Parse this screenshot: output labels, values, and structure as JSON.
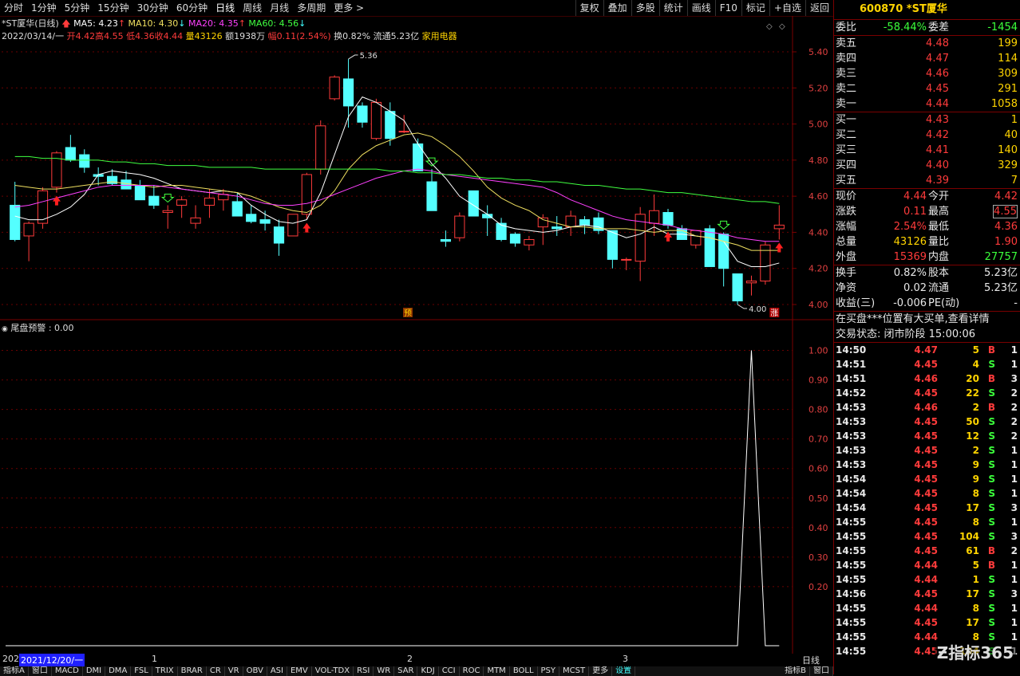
{
  "toolbar": {
    "left": [
      "分时",
      "1分钟",
      "5分钟",
      "15分钟",
      "30分钟",
      "60分钟",
      "日线",
      "周线",
      "月线",
      "多周期",
      "更多 >"
    ],
    "right": [
      "复权",
      "叠加",
      "多股",
      "统计",
      "画线",
      "F10",
      "标记",
      "+自选",
      "返回"
    ]
  },
  "legend": {
    "title": "*ST厦华(日线)",
    "ma5": "MA5: 4.23",
    "ma10": "MA10: 4.30",
    "ma20": "MA20: 4.35",
    "ma60": "MA60: 4.56"
  },
  "ohlc_line": {
    "date": "2022/03/14/一",
    "open": "开4.42",
    "high": "高4.55",
    "low": "低4.36",
    "close": "收4.44",
    "vol": "量43126",
    "amount": "额1938万",
    "change": "幅0.11(2.54%)",
    "turnover": "换0.82%",
    "float": "流通5.23亿",
    "industry": "家用电器"
  },
  "indicator": {
    "label": "尾盘预警 : 0.00"
  },
  "annotations": {
    "high_label": "5.36",
    "low_label": "4.00",
    "yu_tag": "预",
    "zhang_tag": "涨"
  },
  "bottom_tabs": [
    "指标A",
    "窗口",
    "MACD",
    "DMI",
    "DMA",
    "FSL",
    "TRIX",
    "BRAR",
    "CR",
    "VR",
    "OBV",
    "ASI",
    "EMV",
    "VOL-TDX",
    "RSI",
    "WR",
    "SAR",
    "KDJ",
    "CCI",
    "ROC",
    "MTM",
    "BOLL",
    "PSY",
    "MCST",
    "更多",
    "设置"
  ],
  "bottom_right_tabs": [
    "指标B",
    "窗口"
  ],
  "date_bar": {
    "cursor_date": "2021/12/20/一",
    "prefix": "202",
    "m1": "1",
    "m2": "2",
    "m3": "3",
    "period": "日线"
  },
  "chart_data": {
    "type": "candlestick",
    "ylim": [
      4.0,
      5.4
    ],
    "yticks": [
      "5.40",
      "5.20",
      "5.00",
      "4.80",
      "4.60",
      "4.40",
      "4.20",
      "4.00"
    ],
    "candles": [
      [
        4.55,
        4.68,
        4.35,
        4.36
      ],
      [
        4.38,
        4.46,
        4.24,
        4.45
      ],
      [
        4.45,
        4.65,
        4.42,
        4.63
      ],
      [
        4.65,
        4.85,
        4.62,
        4.84
      ],
      [
        4.87,
        4.94,
        4.79,
        4.8
      ],
      [
        4.83,
        4.86,
        4.73,
        4.76
      ],
      [
        4.72,
        4.76,
        4.66,
        4.71
      ],
      [
        4.71,
        4.75,
        4.66,
        4.67
      ],
      [
        4.69,
        4.74,
        4.65,
        4.64
      ],
      [
        4.66,
        4.69,
        4.59,
        4.58
      ],
      [
        4.6,
        4.66,
        4.53,
        4.55
      ],
      [
        4.51,
        4.55,
        4.42,
        4.52
      ],
      [
        4.55,
        4.6,
        4.48,
        4.58
      ],
      [
        4.45,
        4.55,
        4.42,
        4.48
      ],
      [
        4.55,
        4.64,
        4.48,
        4.59
      ],
      [
        4.58,
        4.64,
        4.52,
        4.61
      ],
      [
        4.57,
        4.62,
        4.5,
        4.49
      ],
      [
        4.5,
        4.55,
        4.45,
        4.46
      ],
      [
        4.47,
        4.52,
        4.41,
        4.45
      ],
      [
        4.43,
        4.47,
        4.27,
        4.34
      ],
      [
        4.38,
        4.5,
        4.38,
        4.5
      ],
      [
        4.5,
        4.73,
        4.47,
        4.72
      ],
      [
        4.75,
        5.02,
        4.72,
        4.99
      ],
      [
        5.14,
        5.27,
        5.13,
        5.26
      ],
      [
        5.25,
        5.36,
        4.98,
        5.1
      ],
      [
        5.1,
        5.12,
        4.98,
        5.01
      ],
      [
        4.92,
        5.14,
        4.91,
        5.12
      ],
      [
        5.07,
        5.12,
        4.88,
        4.92
      ],
      [
        4.96,
        5.05,
        4.95,
        4.96
      ],
      [
        4.89,
        4.92,
        4.79,
        4.74
      ],
      [
        4.68,
        4.75,
        4.52,
        4.52
      ],
      [
        4.36,
        4.41,
        4.32,
        4.35
      ],
      [
        4.37,
        4.51,
        4.35,
        4.49
      ],
      [
        4.63,
        4.63,
        4.49,
        4.49
      ],
      [
        4.5,
        4.55,
        4.38,
        4.48
      ],
      [
        4.45,
        4.48,
        4.35,
        4.36
      ],
      [
        4.39,
        4.4,
        4.32,
        4.34
      ],
      [
        4.33,
        4.38,
        4.3,
        4.36
      ],
      [
        4.43,
        4.5,
        4.33,
        4.48
      ],
      [
        4.43,
        4.49,
        4.38,
        4.42
      ],
      [
        4.43,
        4.52,
        4.38,
        4.49
      ],
      [
        4.47,
        4.49,
        4.39,
        4.44
      ],
      [
        4.48,
        4.51,
        4.39,
        4.41
      ],
      [
        4.41,
        4.41,
        4.2,
        4.25
      ],
      [
        4.25,
        4.26,
        4.19,
        4.25
      ],
      [
        4.24,
        4.54,
        4.13,
        4.5
      ],
      [
        4.45,
        4.61,
        4.38,
        4.52
      ],
      [
        4.51,
        4.53,
        4.42,
        4.44
      ],
      [
        4.42,
        4.44,
        4.36,
        4.36
      ],
      [
        4.33,
        4.41,
        4.31,
        4.41
      ],
      [
        4.42,
        4.44,
        4.22,
        4.21
      ],
      [
        4.39,
        4.4,
        4.1,
        4.2
      ],
      [
        4.17,
        4.17,
        4.0,
        4.02
      ],
      [
        4.12,
        4.16,
        4.05,
        4.13
      ],
      [
        4.13,
        4.35,
        4.11,
        4.33
      ],
      [
        4.42,
        4.55,
        4.36,
        4.44
      ]
    ],
    "ma5": [
      4.49,
      4.47,
      4.47,
      4.5,
      4.54,
      4.61,
      4.72,
      4.74,
      4.73,
      4.72,
      4.7,
      4.67,
      4.64,
      4.63,
      4.62,
      4.63,
      4.62,
      4.55,
      4.5,
      4.46,
      4.45,
      4.47,
      4.62,
      4.83,
      5.04,
      5.15,
      5.12,
      5.07,
      5.02,
      4.89,
      4.78,
      4.7,
      4.6,
      4.55,
      4.5,
      4.44,
      4.42,
      4.41,
      4.4,
      4.41,
      4.43,
      4.44,
      4.43,
      4.4,
      4.37,
      4.39,
      4.43,
      4.39,
      4.39,
      4.38,
      4.37,
      4.35,
      4.24,
      4.21,
      4.21,
      4.23
    ],
    "ma10": [
      4.66,
      4.65,
      4.64,
      4.64,
      4.65,
      4.66,
      4.67,
      4.68,
      4.67,
      4.66,
      4.65,
      4.66,
      4.66,
      4.65,
      4.64,
      4.63,
      4.62,
      4.6,
      4.57,
      4.54,
      4.52,
      4.51,
      4.55,
      4.63,
      4.75,
      4.83,
      4.88,
      4.91,
      4.94,
      4.95,
      4.93,
      4.88,
      4.82,
      4.74,
      4.65,
      4.59,
      4.55,
      4.52,
      4.47,
      4.45,
      4.43,
      4.43,
      4.42,
      4.42,
      4.42,
      4.41,
      4.4,
      4.41,
      4.41,
      4.38,
      4.37,
      4.35,
      4.33,
      4.3,
      4.3,
      4.3
    ],
    "ma20": [
      4.54,
      4.55,
      4.57,
      4.59,
      4.61,
      4.63,
      4.65,
      4.66,
      4.66,
      4.66,
      4.66,
      4.65,
      4.64,
      4.63,
      4.62,
      4.61,
      4.6,
      4.58,
      4.56,
      4.55,
      4.55,
      4.56,
      4.58,
      4.61,
      4.64,
      4.67,
      4.7,
      4.72,
      4.74,
      4.75,
      4.74,
      4.72,
      4.71,
      4.7,
      4.69,
      4.68,
      4.67,
      4.66,
      4.65,
      4.62,
      4.58,
      4.55,
      4.52,
      4.49,
      4.47,
      4.46,
      4.45,
      4.44,
      4.42,
      4.41,
      4.4,
      4.39,
      4.37,
      4.36,
      4.35,
      4.35
    ],
    "ma60": [
      4.82,
      4.82,
      4.81,
      4.81,
      4.8,
      4.8,
      4.8,
      4.79,
      4.79,
      4.78,
      4.78,
      4.77,
      4.77,
      4.77,
      4.76,
      4.76,
      4.76,
      4.76,
      4.75,
      4.75,
      4.75,
      4.75,
      4.75,
      4.75,
      4.75,
      4.75,
      4.75,
      4.74,
      4.74,
      4.73,
      4.73,
      4.72,
      4.72,
      4.71,
      4.7,
      4.7,
      4.69,
      4.69,
      4.68,
      4.68,
      4.67,
      4.66,
      4.66,
      4.65,
      4.64,
      4.64,
      4.63,
      4.62,
      4.62,
      4.61,
      4.6,
      4.59,
      4.58,
      4.57,
      4.57,
      4.56
    ],
    "indicator": {
      "name": "尾盘预警",
      "ylim": [
        0,
        1.05
      ],
      "yticks": [
        "1.00",
        "0.90",
        "0.80",
        "0.70",
        "0.60",
        "0.50",
        "0.40",
        "0.30",
        "0.20"
      ],
      "values": [
        0,
        0,
        0,
        0,
        0,
        0,
        0,
        0,
        0,
        0,
        0,
        0,
        0,
        0,
        0,
        0,
        0,
        0,
        0,
        0,
        0,
        0,
        0,
        0,
        0,
        0,
        0,
        0,
        0,
        0,
        0,
        0,
        0,
        0,
        0,
        0,
        0,
        0,
        0,
        0,
        0,
        0,
        0,
        0,
        0,
        0,
        0,
        0,
        0,
        0,
        0,
        0,
        0,
        1,
        0,
        0
      ]
    },
    "buy_arrow_index": [
      3,
      21,
      47,
      55
    ],
    "down_arrow_index": [
      11,
      30,
      51
    ]
  },
  "colors": {
    "up": "#ff3b3b",
    "down": "#54ffff",
    "ma5": "#ffffff",
    "ma10": "#f0e060",
    "ma20": "#ff40ff",
    "ma60": "#40ff40"
  },
  "panel": {
    "title": "600870 *ST厦华",
    "weibi_label": "委比",
    "weibi": "-58.44%",
    "weicha_label": "委差",
    "weicha": "-1454",
    "asks": [
      {
        "label": "卖五",
        "price": "4.48",
        "vol": "199"
      },
      {
        "label": "卖四",
        "price": "4.47",
        "vol": "114"
      },
      {
        "label": "卖三",
        "price": "4.46",
        "vol": "309"
      },
      {
        "label": "卖二",
        "price": "4.45",
        "vol": "291"
      },
      {
        "label": "卖一",
        "price": "4.44",
        "vol": "1058"
      }
    ],
    "bids": [
      {
        "label": "买一",
        "price": "4.43",
        "vol": "1"
      },
      {
        "label": "买二",
        "price": "4.42",
        "vol": "40"
      },
      {
        "label": "买三",
        "price": "4.41",
        "vol": "140"
      },
      {
        "label": "买四",
        "price": "4.40",
        "vol": "329"
      },
      {
        "label": "买五",
        "price": "4.39",
        "vol": "7"
      }
    ],
    "stats": [
      {
        "l1": "现价",
        "v1": "4.44",
        "l2": "今开",
        "v2": "4.42"
      },
      {
        "l1": "涨跌",
        "v1": "0.11",
        "l2": "最高",
        "v2": "4.55"
      },
      {
        "l1": "涨幅",
        "v1": "2.54%",
        "l2": "最低",
        "v2": "4.36"
      },
      {
        "l1": "总量",
        "v1": "43126",
        "l2": "量比",
        "v2": "1.90"
      },
      {
        "l1": "外盘",
        "v1": "15369",
        "l2": "内盘",
        "v2": "27757"
      }
    ],
    "fund": [
      {
        "l1": "换手",
        "v1": "0.82%",
        "l2": "股本",
        "v2": "5.23亿"
      },
      {
        "l1": "净资",
        "v1": "0.02",
        "l2": "流通",
        "v2": "5.23亿"
      },
      {
        "l1": "收益(三)",
        "v1": "-0.006",
        "l2": "PE(动)",
        "v2": "-"
      }
    ],
    "notice": "在买盘***位置有大买单,查看详情",
    "status": "交易状态: 闭市阶段 15:00:06",
    "ticks": [
      [
        "14:50",
        "4.47",
        "5",
        "B",
        "1"
      ],
      [
        "14:51",
        "4.45",
        "4",
        "S",
        "1"
      ],
      [
        "14:51",
        "4.46",
        "20",
        "B",
        "3"
      ],
      [
        "14:52",
        "4.45",
        "22",
        "S",
        "2"
      ],
      [
        "14:53",
        "4.46",
        "2",
        "B",
        "2"
      ],
      [
        "14:53",
        "4.45",
        "50",
        "S",
        "2"
      ],
      [
        "14:53",
        "4.45",
        "12",
        "S",
        "2"
      ],
      [
        "14:53",
        "4.45",
        "2",
        "S",
        "1"
      ],
      [
        "14:53",
        "4.45",
        "9",
        "S",
        "1"
      ],
      [
        "14:54",
        "4.45",
        "9",
        "S",
        "1"
      ],
      [
        "14:54",
        "4.45",
        "8",
        "S",
        "1"
      ],
      [
        "14:54",
        "4.45",
        "17",
        "S",
        "3"
      ],
      [
        "14:55",
        "4.45",
        "8",
        "S",
        "1"
      ],
      [
        "14:55",
        "4.45",
        "104",
        "S",
        "3"
      ],
      [
        "14:55",
        "4.45",
        "61",
        "B",
        "2"
      ],
      [
        "14:55",
        "4.44",
        "5",
        "B",
        "1"
      ],
      [
        "14:55",
        "4.44",
        "1",
        "S",
        "1"
      ],
      [
        "14:56",
        "4.45",
        "17",
        "S",
        "3"
      ],
      [
        "14:55",
        "4.44",
        "8",
        "S",
        "1"
      ],
      [
        "14:55",
        "4.45",
        "17",
        "S",
        "1"
      ],
      [
        "14:55",
        "4.44",
        "8",
        "S",
        "1"
      ],
      [
        "14:55",
        "4.45",
        "104",
        "S",
        "1"
      ]
    ],
    "logo": "指标365"
  }
}
